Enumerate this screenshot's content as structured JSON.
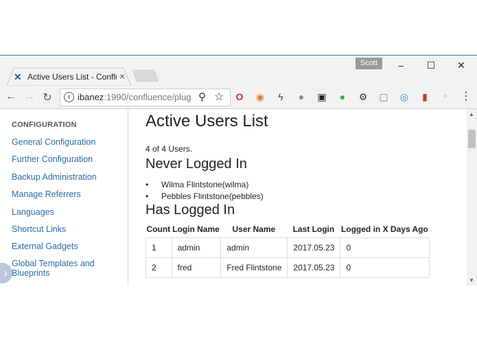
{
  "browser": {
    "tab_title": "Active Users List - Conflu",
    "tab_close": "×",
    "profile_name": "Scott",
    "url_host": "ibanez",
    "url_rest": ":1990/confluence/plug",
    "window_buttons": [
      "–",
      "☐",
      "✕"
    ],
    "nav": {
      "back": "←",
      "forward": "→",
      "reload": "↻"
    },
    "zoom_icon": "⚲",
    "star_icon": "☆",
    "menu_icon": "⋮"
  },
  "sidebar": {
    "heading": "CONFIGURATION",
    "items": [
      {
        "label": "General Configuration"
      },
      {
        "label": "Further Configuration"
      },
      {
        "label": "Backup Administration"
      },
      {
        "label": "Manage Referrers"
      },
      {
        "label": "Languages"
      },
      {
        "label": "Shortcut Links"
      },
      {
        "label": "External Gadgets"
      },
      {
        "label": "Global Templates and Blueprints"
      }
    ]
  },
  "main": {
    "title": "Active Users List",
    "count_text": "4 of 4 Users.",
    "never_logged_in": {
      "heading": "Never Logged In",
      "users": [
        "Wilma Flintstone(wilma)",
        "Pebbles Flintstone(pebbles)"
      ]
    },
    "has_logged_in": {
      "heading": "Has Logged In",
      "columns": [
        "Count",
        "Login Name",
        "User Name",
        "Last Login",
        "Logged in X Days Ago"
      ],
      "rows": [
        [
          "1",
          "admin",
          "admin",
          "2017.05.23",
          "0"
        ],
        [
          "2",
          "fred",
          "Fred Flintstone",
          "2017.05.23",
          "0"
        ]
      ]
    }
  },
  "colors": {
    "link": "#2f6aa6",
    "window_border": "#3c7fb1"
  }
}
